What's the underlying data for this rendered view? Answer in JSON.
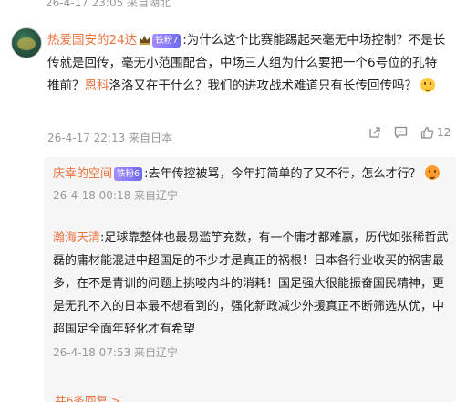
{
  "top_meta": "26-4-17 23:05 来自湖北",
  "comment": {
    "username": "热爱国安的24达",
    "badge": "铁粉7",
    "text_1": ":为什么这个比赛能踢起来毫无中场控制？不是长传就是回传，毫无小范围配合，中场三人组为什么要把一个6号位的孔特推前？",
    "highlight": "恩科",
    "text_2": "洛洛又在干什么？我们的进攻战术难道只有长传回传吗？",
    "emoji": "thinking-emoji",
    "meta": "26-4-17 22:13 来自日本",
    "like_count": "12"
  },
  "replies": [
    {
      "username": "庆幸的空间",
      "badge": "铁粉6",
      "text": ":去年传控被骂，今年打简单的了又不行，怎么才行？",
      "emoji": "angry-emoji",
      "meta": "26-4-18 00:18 来自辽宁"
    },
    {
      "username": "瀚海天清",
      "text": ":足球靠整体也最易滥竽充数，有一个庸才都难赢，历代如张稀哲武磊的庸材能混进中超国足的不少才是真正的祸根！日本各行业收买的祸害最多，在不是青训的问题上挑唆内斗的消耗！国足强大很能振奋国民精神，更是无孔不入的日本最不想看到的，强化新政减少外援真正不断筛选从优，中超国足全面年轻化才有希望",
      "meta": "26-4-18 07:53 来自辽宁"
    }
  ],
  "more_replies": "共6条回复 >",
  "colors": {
    "accent": "#eb7340",
    "meta": "#999999",
    "reply_bg": "#f6f6f6"
  }
}
